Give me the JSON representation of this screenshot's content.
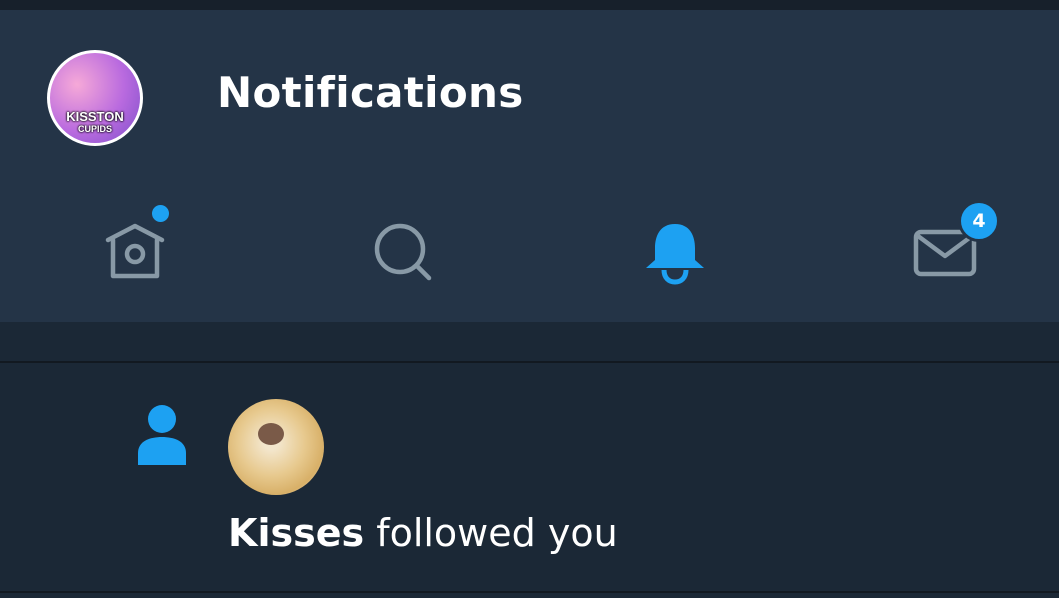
{
  "header": {
    "title": "Notifications",
    "profile_avatar_text": "KISSTON",
    "profile_avatar_subtext": "CUPIDS"
  },
  "tabs": [
    {
      "name": "home",
      "icon": "home-icon",
      "unread_dot": true
    },
    {
      "name": "search",
      "icon": "search-icon"
    },
    {
      "name": "notifications",
      "icon": "bell-icon",
      "active": true
    },
    {
      "name": "messages",
      "icon": "mail-icon",
      "badge": "4"
    }
  ],
  "notification": {
    "icon": "person-icon",
    "user": "Kisses",
    "action": " followed you"
  },
  "colors": {
    "accent": "#1da1f2",
    "header_bg": "#243447",
    "page_bg": "#1b2836",
    "icon_inactive": "#8899a6"
  }
}
